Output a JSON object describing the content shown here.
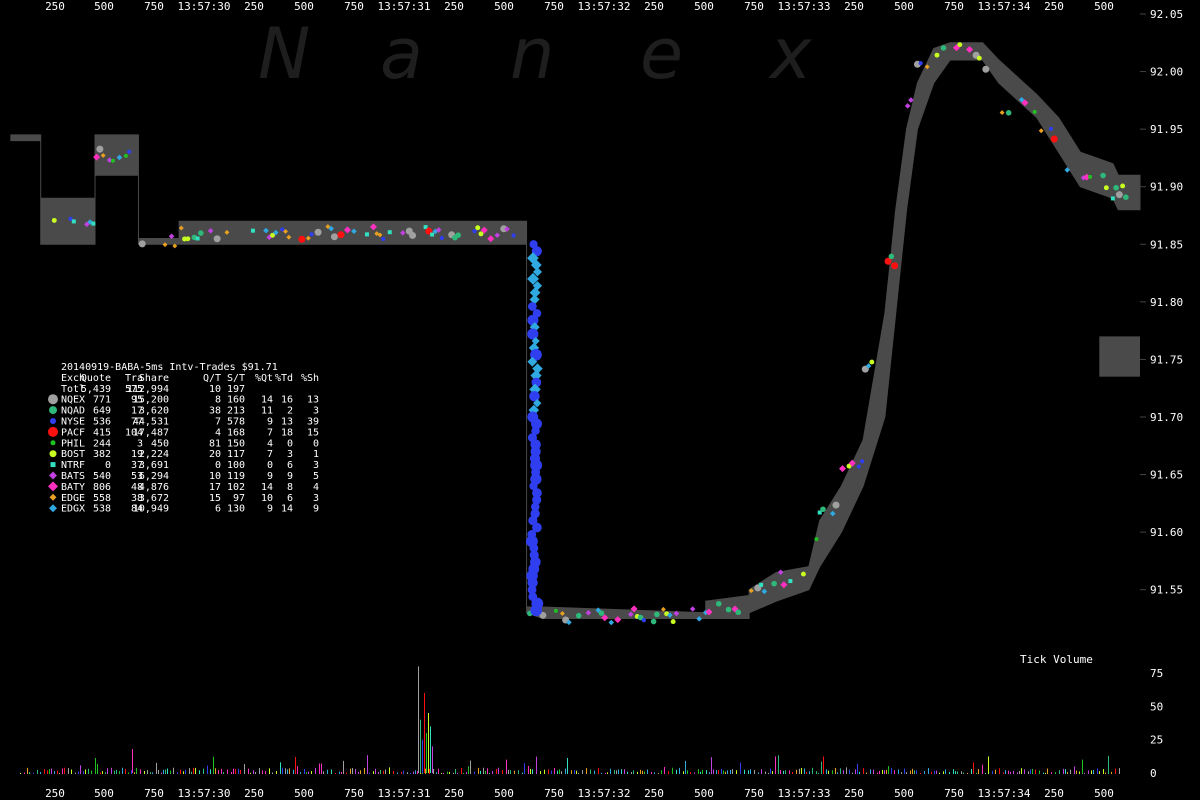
{
  "watermark": [
    "N",
    "a",
    "n",
    "e",
    "x"
  ],
  "legend": {
    "title": "20140919-BABA-5ms Intv-Trades $91.71",
    "header": [
      "Exch",
      "Quote",
      "Tra",
      "Share",
      "Q/T",
      "S/T",
      "%Qt",
      "%Td",
      "%Sh"
    ],
    "total": [
      "Totl",
      "5,439",
      "575",
      "112,994",
      "10",
      "197",
      "",
      "",
      ""
    ],
    "rows": [
      {
        "exch": "NQEX",
        "cols": [
          "771",
          "95",
          "15,200",
          "8",
          "160",
          "14",
          "16",
          "13"
        ],
        "color": "#a0a0a0",
        "shape": "circle",
        "size": 5
      },
      {
        "exch": "NQAD",
        "cols": [
          "649",
          "17",
          "3,620",
          "38",
          "213",
          "11",
          "2",
          "3"
        ],
        "color": "#2eb87a",
        "shape": "circle",
        "size": 4
      },
      {
        "exch": "NYSE",
        "cols": [
          "536",
          "77",
          "44,531",
          "7",
          "578",
          "9",
          "13",
          "39"
        ],
        "color": "#2f3ff0",
        "shape": "circle",
        "size": 3
      },
      {
        "exch": "PACF",
        "cols": [
          "415",
          "104",
          "17,487",
          "4",
          "168",
          "7",
          "18",
          "15"
        ],
        "color": "#ff1010",
        "shape": "circle",
        "size": 5
      },
      {
        "exch": "PHIL",
        "cols": [
          "244",
          "3",
          "450",
          "81",
          "150",
          "4",
          "0",
          "0"
        ],
        "color": "#20c020",
        "shape": "circle",
        "size": 2.5
      },
      {
        "exch": "BOST",
        "cols": [
          "382",
          "19",
          "2,224",
          "20",
          "117",
          "7",
          "3",
          "1"
        ],
        "color": "#c8ff20",
        "shape": "circle",
        "size": 3.5
      },
      {
        "exch": "NTRF",
        "cols": [
          "0",
          "37",
          "3,691",
          "0",
          "100",
          "0",
          "6",
          "3"
        ],
        "color": "#30e0c0",
        "shape": "square",
        "size": 2.5
      },
      {
        "exch": "BATS",
        "cols": [
          "540",
          "53",
          "6,294",
          "10",
          "119",
          "9",
          "9",
          "5"
        ],
        "color": "#c040e0",
        "shape": "diamond",
        "size": 4
      },
      {
        "exch": "BATY",
        "cols": [
          "806",
          "48",
          "4,876",
          "17",
          "102",
          "14",
          "8",
          "4"
        ],
        "color": "#ff30c0",
        "shape": "diamond",
        "size": 5
      },
      {
        "exch": "EDGE",
        "cols": [
          "558",
          "38",
          "3,672",
          "15",
          "97",
          "10",
          "6",
          "3"
        ],
        "color": "#e8a020",
        "shape": "diamond",
        "size": 3.5
      },
      {
        "exch": "EDGX",
        "cols": [
          "538",
          "84",
          "10,949",
          "6",
          "130",
          "9",
          "14",
          "9"
        ],
        "color": "#30a8e0",
        "shape": "diamond",
        "size": 4
      }
    ]
  },
  "chart_data": {
    "type": "scatter",
    "title": "20140919-BABA-5ms Intv-Trades $91.71",
    "price_axis": {
      "ylim": [
        91.515,
        92.05
      ],
      "ticks": [
        91.55,
        91.6,
        91.65,
        91.7,
        91.75,
        91.8,
        91.85,
        91.9,
        91.95,
        92.0,
        92.05
      ],
      "tick_labels": [
        "91.55",
        "91.60",
        "91.65",
        "91.70",
        "91.75",
        "91.80",
        "91.85",
        "91.90",
        "91.95",
        "92.00",
        "92.05"
      ]
    },
    "volume_axis": {
      "ylim": [
        0,
        100
      ],
      "ticks": [
        0,
        25,
        50,
        75
      ],
      "tick_labels": [
        "0",
        "25",
        "50",
        "75"
      ],
      "label": "Tick Volume"
    },
    "time_axis": {
      "xlim": [
        29.96,
        34.2
      ],
      "ticks": [
        30.25,
        30.5,
        30.75,
        31.0,
        31.25,
        31.5,
        31.75,
        32.0,
        32.25,
        32.5,
        32.75,
        33.0,
        33.25,
        33.5,
        33.75,
        34.0,
        34.25,
        34.5
      ],
      "tick_labels": [
        "250",
        "500",
        "750",
        "13:57:30",
        "250",
        "500",
        "750",
        "13:57:31",
        "250",
        "500",
        "750",
        "13:57:32",
        "250",
        "500",
        "750",
        "13:57:33",
        "250",
        "500",
        "750",
        "13:57:34",
        "250",
        "500"
      ]
    },
    "quote_band": [
      [
        30.04,
        91.94,
        91.945
      ],
      [
        30.15,
        91.94,
        91.945
      ],
      [
        30.15,
        91.85,
        91.89
      ],
      [
        30.35,
        91.85,
        91.89
      ],
      [
        30.35,
        91.91,
        91.945
      ],
      [
        30.51,
        91.91,
        91.945
      ],
      [
        30.51,
        91.85,
        91.855
      ],
      [
        30.66,
        91.85,
        91.855
      ],
      [
        30.66,
        91.85,
        91.87
      ],
      [
        31.94,
        91.85,
        91.87
      ],
      [
        31.94,
        91.53,
        91.535
      ],
      [
        32.0,
        91.525,
        91.535
      ],
      [
        32.6,
        91.525,
        91.53
      ],
      [
        32.6,
        91.525,
        91.54
      ],
      [
        32.76,
        91.525,
        91.545
      ],
      [
        32.76,
        91.53,
        91.55
      ],
      [
        32.86,
        91.54,
        91.565
      ],
      [
        32.98,
        91.55,
        91.57
      ],
      [
        33.02,
        91.57,
        91.61
      ],
      [
        33.1,
        91.6,
        91.64
      ],
      [
        33.18,
        91.64,
        91.68
      ],
      [
        33.26,
        91.7,
        91.79
      ],
      [
        33.3,
        91.79,
        91.88
      ],
      [
        33.34,
        91.88,
        91.95
      ],
      [
        33.38,
        91.95,
        91.99
      ],
      [
        33.44,
        91.99,
        92.02
      ],
      [
        33.5,
        92.01,
        92.025
      ],
      [
        33.62,
        92.01,
        92.025
      ],
      [
        33.68,
        91.99,
        92.01
      ],
      [
        33.82,
        91.96,
        91.98
      ],
      [
        33.9,
        91.93,
        91.96
      ],
      [
        33.98,
        91.9,
        91.93
      ],
      [
        34.1,
        91.89,
        91.92
      ],
      [
        34.12,
        91.88,
        91.91
      ],
      [
        34.2,
        91.88,
        91.91
      ]
    ],
    "volume_hint": "many small bars near zero with a spike of ~80 around 13:57:31.00"
  }
}
